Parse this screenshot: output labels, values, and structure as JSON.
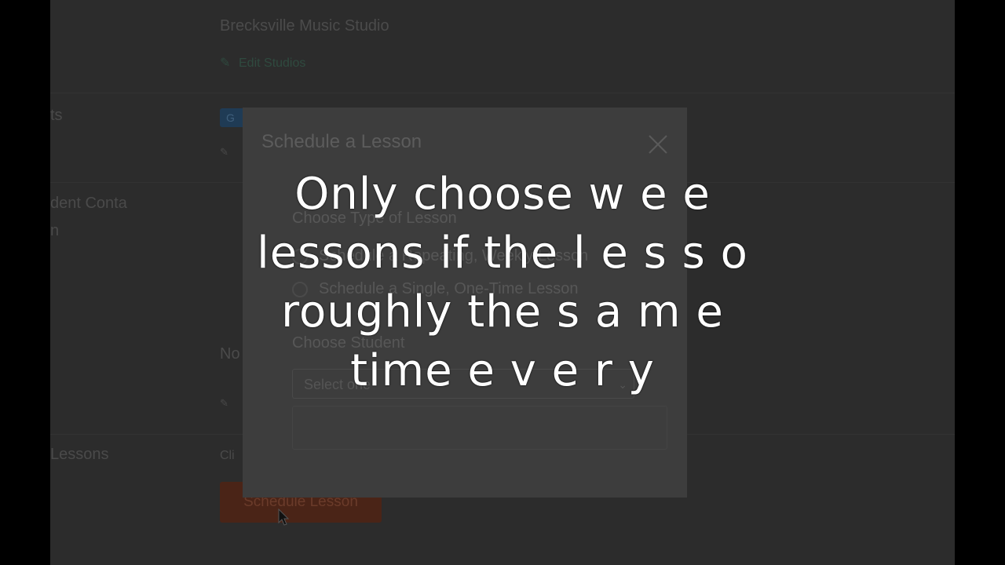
{
  "page": {
    "studio_name": "Brecksville Music Studio",
    "edit_studios": "Edit Studios",
    "side_labels": [
      "ts",
      "dent Conta",
      "n",
      "Lessons"
    ],
    "badge": "G",
    "status_text": "No",
    "click_text": "Cli",
    "schedule_button": "Schedule Lesson"
  },
  "modal": {
    "title": "Schedule a Lesson",
    "close_icon": "close-icon",
    "type_label": "Choose Type of Lesson",
    "option_recurring": "Schedule a Repeating, Weekly Lesson",
    "option_single": "Schedule a Single, One-Time Lesson",
    "student_label": "Choose Student",
    "student_select_value": "Select one"
  },
  "caption": {
    "lines": [
      "Only choose w e e",
      "lessons if the l e s s o",
      "roughly the s a m e",
      "time e v e r y"
    ]
  },
  "colors": {
    "overlay": "#2c2c2c",
    "modal": "#3d3d3d",
    "button": "#4a2417",
    "caption": "#ffffff"
  }
}
